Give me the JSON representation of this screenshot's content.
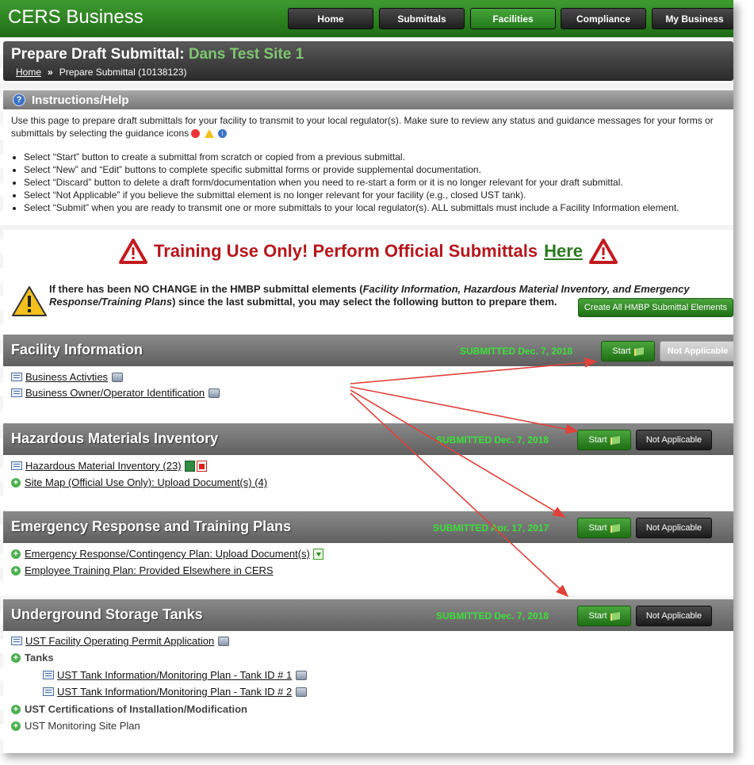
{
  "brand": "CERS Business",
  "nav": [
    "Home",
    "Submittals",
    "Facilities",
    "Compliance",
    "My Business"
  ],
  "nav_active": "Facilities",
  "header": {
    "title_prefix": "Prepare Draft Submittal:",
    "site": "Dans Test Site 1",
    "crumb_home": "Home",
    "crumb_sep": "»",
    "crumb_current": "Prepare Submittal (10138123)"
  },
  "instructions": {
    "title": "Instructions/Help",
    "intro_1": "Use this page to prepare draft submittals for your facility to transmit to your local regulator(s). Make sure to review any status and guidance messages for your forms or",
    "intro_2": "submittals by selecting the guidance icons",
    "bullets": [
      "Select “Start” button to create a submittal from scratch or copied from a previous submittal.",
      "Select “New” and “Edit” buttons to complete specific submittal forms or provide supplemental documentation.",
      "Select “Discard” button to delete a draft form/documentation when you need to re-start a form or it is no longer relevant for your draft submittal.",
      "Select “Not Applicable” if you believe the submittal element is no longer relevant for your facility (e.g., closed UST tank).",
      "Select “Submit” when you are ready to transmit one or more submittals to your local regulator(s). ALL submittals must include a Facility Information element."
    ]
  },
  "banner": {
    "text": "Training Use Only! Perform Official Submittals",
    "link": "Here"
  },
  "no_change": {
    "text_a": "If there has been NO CHANGE in the HMBP submittal elements (",
    "text_italic": "Facility Information, Hazardous Material Inventory, and Emergency Response/Training Plans",
    "text_b": ") since the last submittal, you may select the following button to prepare them.",
    "button": "Create All HMBP Submittal Elements"
  },
  "sections": [
    {
      "title": "Facility Information",
      "status": "SUBMITTED Dec. 7, 2018",
      "start": "Start",
      "na": "Not Applicable",
      "items": [
        "Business Activties",
        "Business Owner/Operator Identification"
      ]
    },
    {
      "title": "Hazardous Materials Inventory",
      "status": "SUBMITTED Dec. 7, 2018",
      "start": "Start",
      "na": "Not Applicable",
      "items": [
        "Hazardous Material Inventory (23)",
        "Site Map (Official Use Only): Upload Document(s) (4)"
      ]
    },
    {
      "title": "Emergency Response and Training Plans",
      "status": "SUBMITTED Apr. 17, 2017",
      "start": "Start",
      "na": "Not Applicable",
      "items": [
        "Emergency Response/Contingency Plan: Upload Document(s)",
        "Employee Training Plan: Provided Elsewhere in CERS"
      ]
    },
    {
      "title": "Underground Storage Tanks",
      "status": "SUBMITTED Dec. 7, 2018",
      "start": "Start",
      "na": "Not Applicable",
      "items": [
        "UST Facility Operating Permit Application",
        "Tanks",
        "UST Tank Information/Monitoring Plan - Tank ID # 1",
        "UST Tank Information/Monitoring Plan - Tank ID # 2",
        "UST Certifications of Installation/Modification",
        "UST Monitoring Site Plan"
      ]
    }
  ],
  "colors": {
    "brand_green": "#2a7a1f",
    "status_green": "#3ce039",
    "alert_red": "#b5161b",
    "annotation_arrow": "#e0413b"
  }
}
